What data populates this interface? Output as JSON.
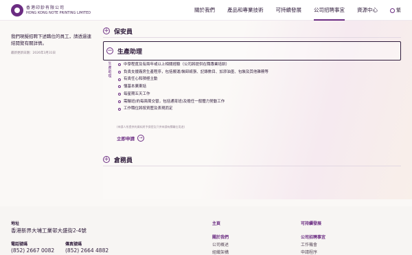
{
  "header": {
    "logo_zh": "香港印鈔有限公司",
    "logo_en": "HONG KONG NOTE PRINTING LIMITED",
    "nav": [
      "關於我們",
      "產品和專業技術",
      "可持續發展",
      "公司招聘事宜",
      "資源中心"
    ],
    "active_nav": "公司招聘事宜",
    "language": "繁"
  },
  "sidebar": {
    "intro": "我們現擬招聘下述職位的員工，請透過連結閱覽有關詳情。",
    "updated": "最新更新日期：2026年3月31日"
  },
  "accordion": {
    "item1_title": "保安員",
    "item2_title": "生產助理",
    "item2_vertical": "生產助理",
    "item3_title": "倉務員",
    "requirements": [
      "中學程度及有兩年或以上相關經驗（公司將提供在職專業培訓）",
      "負責支援廠房生產程序，包括搬運/裝卸紙張、記錄數目、加添油墨、包裝及其他雜務等",
      "有責任心和積極主動",
      "懂基本廣東話",
      "每星期五天工作",
      "需輪班(約每兩周交替，包括通宵班)及擔任一般體力勞動工作",
      "工作職位將按資歷及表現而定"
    ],
    "note": "(申請人所提供的資料將予保密及只供申請有關職位用途)",
    "apply_label": "立即申請",
    "apply_arrow": "→"
  },
  "footer": {
    "address_label": "地址",
    "address": "香港新界大埔工業邨大盛街2-4號",
    "phone_label": "電話號碼",
    "phone": "(852) 2667 0082",
    "fax_label": "傳真號碼",
    "fax": "(852) 2664 4882",
    "links": {
      "home": "主頁",
      "about": "關於我們",
      "overview": "公司概述",
      "structure": "組織架構",
      "sustainability": "可持續發展",
      "careers": "公司招聘事宜",
      "jobs": "工作機會",
      "procedure": "申請程序"
    }
  },
  "colors": {
    "brand": "#6b2c82",
    "text": "#2e1a3a"
  }
}
